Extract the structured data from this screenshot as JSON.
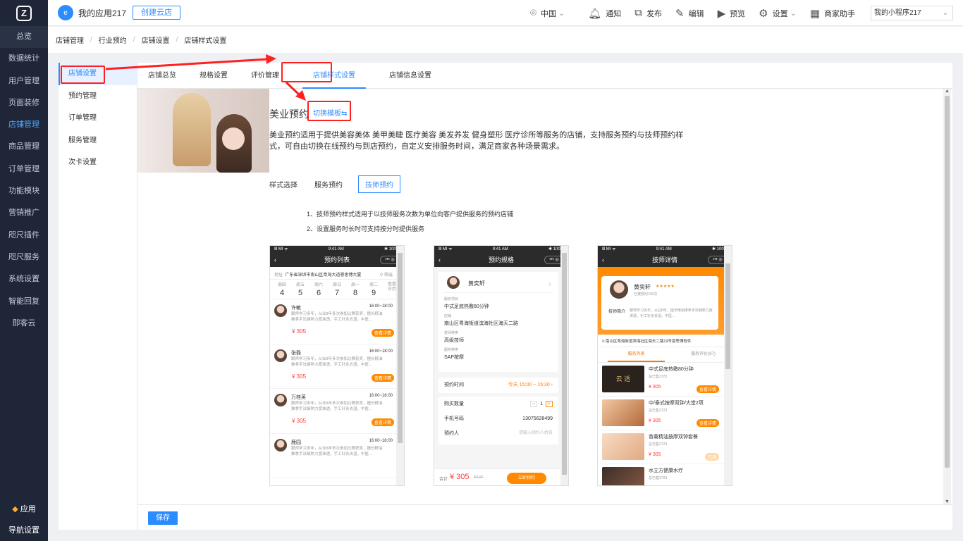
{
  "left_nav": {
    "items": [
      "总览",
      "数据统计",
      "用户管理",
      "页面装修",
      "店铺管理",
      "商品管理",
      "订单管理",
      "功能模块",
      "营销推广",
      "咫尺插件",
      "咫尺服务",
      "系统设置",
      "智能回复",
      "即客云"
    ],
    "bottom": [
      "应用",
      "导航设置"
    ]
  },
  "topbar": {
    "app_name": "我的应用217",
    "create_button": "创建云店",
    "region": "中国",
    "items": [
      "通知",
      "发布",
      "编辑",
      "预览",
      "设置",
      "商家助手"
    ],
    "mini_select": "我的小程序217"
  },
  "breadcrumb": [
    "店铺管理",
    "行业预约",
    "店铺设置",
    "店铺样式设置"
  ],
  "sub_nav": [
    "店铺设置",
    "预约管理",
    "订单管理",
    "服务管理",
    "次卡设置"
  ],
  "tabs": [
    "店铺总览",
    "规格设置",
    "评价管理",
    "店铺样式设置",
    "店铺信息设置"
  ],
  "template": {
    "title": "美业预约",
    "switch_link": "切换模板⇆",
    "description": "美业预约适用于提供美容美体 美甲美睫 医疗美容 美发养发 健身塑形 医疗诊所等服务的店铺，支持服务预约与技师预约样式，可自由切换在线预约与到店预约，自定义安排服务时间，满足商家各种场景需求。"
  },
  "style_select": {
    "label": "样式选择",
    "options": [
      "服务预约",
      "技师预约"
    ],
    "selected": "技师预约"
  },
  "notes": [
    "1、技师预约样式适用于以技师服务次数为单位向客户提供服务的预约店铺",
    "2、设置服务时长时可支持按分时提供服务"
  ],
  "phone_common": {
    "signal": "Ⅲ MI ᯤ",
    "time": "9:41 AM",
    "battery": "✱ 100%"
  },
  "phone1": {
    "title": "预约列表",
    "addr_label": "地址",
    "addr": "广东省深圳市南山区粤海大道恩思博大厦",
    "filter": "筛选",
    "days": [
      {
        "w": "周四",
        "d": "4"
      },
      {
        "w": "周五",
        "d": "5"
      },
      {
        "w": "周六",
        "d": "6"
      },
      {
        "w": "周日",
        "d": "7"
      },
      {
        "w": "周一",
        "d": "8"
      },
      {
        "w": "周二",
        "d": "9"
      }
    ],
    "more": "查看\n日历",
    "techs": [
      {
        "name": "许敏",
        "time": "16:00~18:00",
        "desc": "跟师学习多年，从业8年多次参加比赛获奖，擅长精油推拿手法娴熟力度准透，手工针灸去湿，中医...",
        "price": "¥ 305",
        "btn": "查看详情"
      },
      {
        "name": "张磊",
        "time": "16:00~18:00",
        "desc": "跟师学习多年，从业8年多次参加比赛获奖，擅长精油推拿手法娴熟力度准透，手工针灸去湿，中医...",
        "price": "¥ 305",
        "btn": "查看详情"
      },
      {
        "name": "万桂英",
        "time": "16:00~18:00",
        "desc": "跟师学习多年，从业8年多次参加比赛获奖，擅长精油推拿手法娴熟力度准透，手工针灸去湿，中医...",
        "price": "¥ 305",
        "btn": "查看详情"
      },
      {
        "name": "鹿园",
        "time": "16:00~18:00",
        "desc": "跟师学习多年，从业8年多次参加比赛获奖，擅长精油推拿手法娴熟力度准透，手工针灸去湿，中医...",
        "price": "",
        "btn": ""
      }
    ]
  },
  "phone2": {
    "title": "预约规格",
    "tech_name": "黄奕轩",
    "fields": [
      {
        "label": "服务项目",
        "value": "中式足底热敷80分钟"
      },
      {
        "label": "店铺",
        "value": "南山区粤海街道滨海社区海天二路"
      },
      {
        "label": "技师种类",
        "value": "高级技师"
      },
      {
        "label": "服务种类",
        "value": "SAP按摩"
      }
    ],
    "time_label": "预约时间",
    "time_value": "今天 15:00 ~ 15:30 ›",
    "qty_label": "购买数量",
    "qty": "1",
    "phone_label": "手机号码",
    "phone_value": "13075628499",
    "person_label": "预约人",
    "person_placeholder": "请输入预约人姓名",
    "total_label": "合计",
    "total": "¥ 305",
    "orig": "¥400",
    "submit": "立即预约"
  },
  "phone3": {
    "title": "技师详情",
    "tech_name": "黄奕轩",
    "stars": "★★★★★",
    "booked": "已被预约100次",
    "intro_label": "技师简介",
    "intro": "跟师学习多年，从业8年，擅长精油推拿手法娴熟力度准透，手工针灸去湿，中医...",
    "addr": "南山区粤海街道滨海社区海天二路19号恩思博软件",
    "tab_active": "服务列表",
    "tab_other": "服务评价(87)",
    "services": [
      {
        "name": "中式足底热敷80分钟",
        "sold": "总已售2723",
        "price": "¥ 305",
        "btn": "查看详情"
      },
      {
        "name": "中/泰式按摩双钟/大堂2项",
        "sold": "总已售2723",
        "price": "¥ 305",
        "btn": "查看详情"
      },
      {
        "name": "香薰精油按摩双钟套餐",
        "sold": "总已售2723",
        "price": "¥ 305",
        "btn": "已满"
      },
      {
        "name": "水立方健康水疗",
        "sold": "总已售2723",
        "price": "",
        "btn": ""
      }
    ],
    "thumb_text": "云 适"
  },
  "footer": {
    "save": "保存"
  },
  "colors": {
    "primary": "#2b8cff",
    "nav_bg": "#1f2638",
    "orange": "#ff8a00",
    "annotation": "#ff2020"
  }
}
